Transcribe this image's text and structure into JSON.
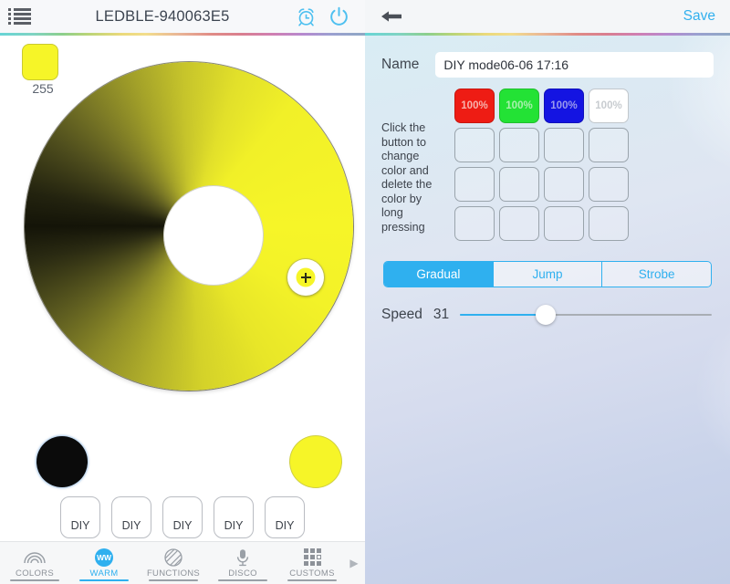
{
  "left_panel": {
    "header": {
      "menu_icon": "list-icon",
      "title": "LEDBLE-940063E5",
      "alarm_icon": "alarm-clock-icon",
      "power_icon": "power-icon"
    },
    "brightness": {
      "value": "255",
      "swatch_color": "#f6f528"
    },
    "color_wheel": {
      "selected_color": "#f6f528",
      "picker_icon": "crosshair-icon"
    },
    "preview_circles": [
      {
        "name": "dark-preview",
        "color": "#0b0b0b"
      },
      {
        "name": "bright-preview",
        "color": "#f6f528"
      }
    ],
    "diy_buttons": [
      "DIY",
      "DIY",
      "DIY",
      "DIY",
      "DIY"
    ],
    "tabs": [
      {
        "label": "COLORS",
        "icon": "rainbow-arc-icon",
        "active": false
      },
      {
        "label": "WARM",
        "icon": "ww-circle-icon",
        "active": true
      },
      {
        "label": "FUNCTIONS",
        "icon": "striped-circle-icon",
        "active": false
      },
      {
        "label": "DISCO",
        "icon": "microphone-icon",
        "active": false
      },
      {
        "label": "CUSTOMS",
        "icon": "grid-icon",
        "active": false
      }
    ],
    "tab_more_icon": "chevron-right-icon",
    "accent_color": "#2fb0ef"
  },
  "right_panel": {
    "header": {
      "back_icon": "back-arrow-icon",
      "save_label": "Save"
    },
    "name_field": {
      "label": "Name",
      "value": "DIY mode06-06 17:16",
      "placeholder": "Name"
    },
    "hint_text": "Click the button to change color and delete the color by long pressing",
    "color_grid": [
      {
        "label": "100%",
        "state": "red"
      },
      {
        "label": "100%",
        "state": "green"
      },
      {
        "label": "100%",
        "state": "blue"
      },
      {
        "label": "100%",
        "state": "white"
      },
      {
        "label": "",
        "state": "empty"
      },
      {
        "label": "",
        "state": "empty"
      },
      {
        "label": "",
        "state": "empty"
      },
      {
        "label": "",
        "state": "empty"
      },
      {
        "label": "",
        "state": "empty"
      },
      {
        "label": "",
        "state": "empty"
      },
      {
        "label": "",
        "state": "empty"
      },
      {
        "label": "",
        "state": "empty"
      },
      {
        "label": "",
        "state": "empty"
      },
      {
        "label": "",
        "state": "empty"
      },
      {
        "label": "",
        "state": "empty"
      },
      {
        "label": "",
        "state": "empty"
      }
    ],
    "mode_segments": [
      {
        "label": "Gradual",
        "selected": true
      },
      {
        "label": "Jump",
        "selected": false
      },
      {
        "label": "Strobe",
        "selected": false
      }
    ],
    "speed": {
      "label": "Speed",
      "value": "31",
      "percent": 34
    },
    "accent_color": "#2fb0ef"
  }
}
